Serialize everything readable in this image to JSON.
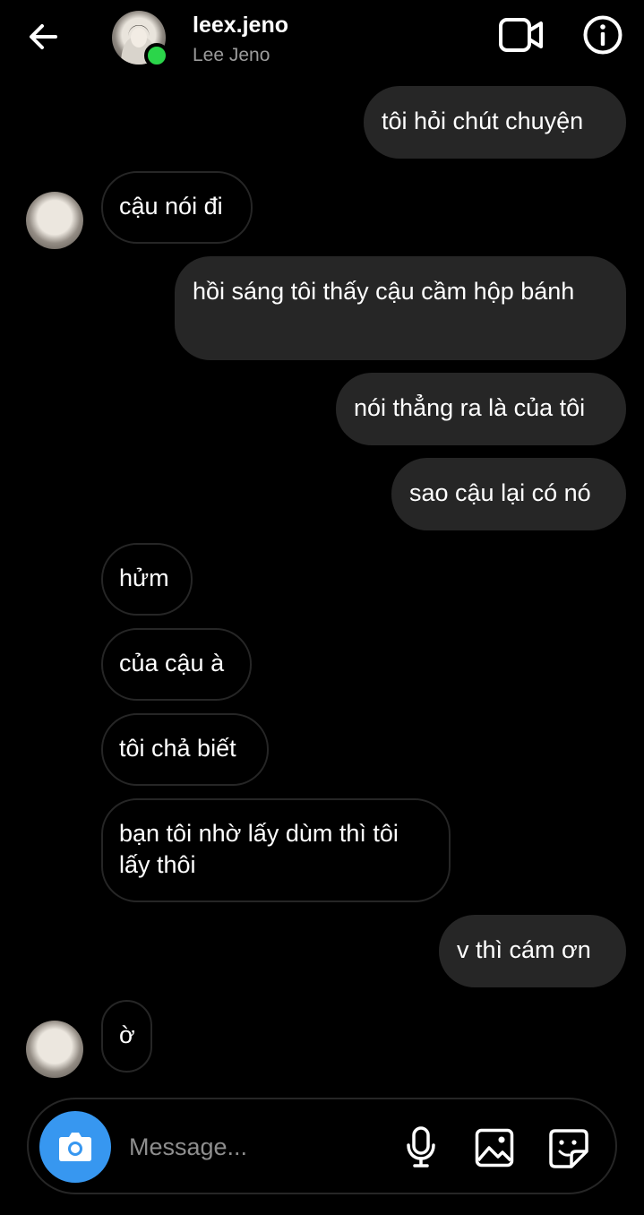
{
  "header": {
    "username": "leex.jeno",
    "display_name": "Lee Jeno",
    "icons": [
      "back-arrow-icon",
      "video-call-icon",
      "info-icon"
    ]
  },
  "messages": [
    {
      "from": "me",
      "text": "tôi hỏi chút chuyện"
    },
    {
      "from": "them",
      "text": "cậu nói đi"
    },
    {
      "from": "me",
      "text": "hồi sáng tôi thấy cậu cầm hộp bánh"
    },
    {
      "from": "me",
      "text": "nói thẳng ra là của tôi"
    },
    {
      "from": "me",
      "text": "sao cậu lại có nó"
    },
    {
      "from": "them",
      "text": "hửm"
    },
    {
      "from": "them",
      "text": "của cậu à"
    },
    {
      "from": "them",
      "text": "tôi chả biết"
    },
    {
      "from": "them",
      "text": "bạn tôi nhờ lấy dùm thì tôi lấy thôi"
    },
    {
      "from": "me",
      "text": "v thì cám ơn"
    },
    {
      "from": "them",
      "text": "ờ"
    }
  ],
  "composer": {
    "placeholder": "Message...",
    "value": "",
    "icons": [
      "camera-icon",
      "microphone-icon",
      "gallery-icon",
      "sticker-icon"
    ]
  },
  "colors": {
    "background": "#000000",
    "outgoing_bubble": "#262626",
    "incoming_border": "#262626",
    "accent": "#3797f0",
    "online": "#2bd54a",
    "secondary_text": "#9b9b9b"
  }
}
